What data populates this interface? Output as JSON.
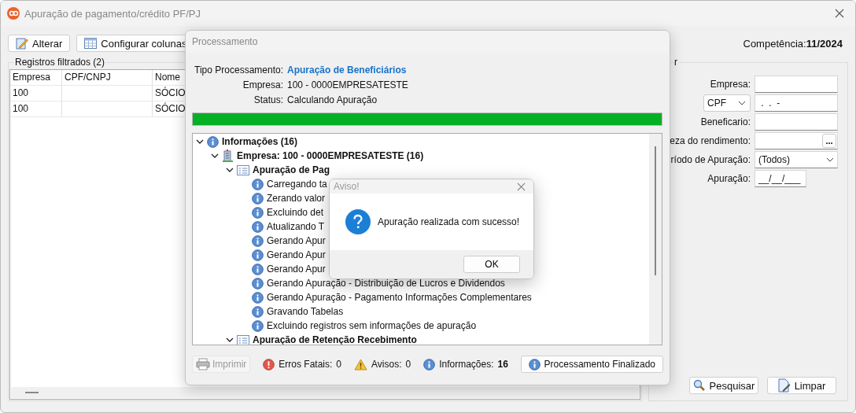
{
  "window": {
    "title": "Apuração de pagamento/crédito PF/PJ"
  },
  "toolbar": {
    "buttons": [
      {
        "label": "Alterar",
        "kind": "edit"
      },
      {
        "label": "Configurar colunas",
        "kind": "columns"
      }
    ],
    "competencia_label": "Competência:",
    "competencia_value": "11/2024"
  },
  "records": {
    "title": "Registros filtrados (2)",
    "columns": [
      "Empresa",
      "CPF/CNPJ",
      "Nome"
    ],
    "rows": [
      {
        "empresa": "100",
        "nome": "SÓCIO"
      },
      {
        "empresa": "100",
        "nome": "SÓCIO"
      }
    ]
  },
  "filter": {
    "title": "r",
    "fields": [
      {
        "label": "Empresa:",
        "kind": "text"
      },
      {
        "kind": "doc",
        "select": "CPF",
        "value": " .  .  -"
      },
      {
        "label": "Beneficario:",
        "kind": "text"
      },
      {
        "label": "eza do rendimento:",
        "kind": "lookup",
        "button": "..."
      },
      {
        "label": "ríodo de Apuração:",
        "kind": "select",
        "value": "(Todos)"
      },
      {
        "label": "Apuração:",
        "kind": "date",
        "value": "__/__/___"
      }
    ],
    "buttons": [
      {
        "label": "Pesquisar",
        "kind": "search"
      },
      {
        "label": "Limpar",
        "kind": "clear"
      }
    ]
  },
  "processing": {
    "title": "Processamento",
    "info": [
      {
        "label": "Tipo Processamento:",
        "value": "Apuração de Beneficiários",
        "link": true
      },
      {
        "label": "Empresa:",
        "value": "100 - 0000EMPRESATESTE",
        "link": false
      },
      {
        "label": "Status:",
        "value": "Calculando Apuração",
        "link": false
      }
    ],
    "progress": {
      "level": 1
    },
    "tree": [
      {
        "text": "Informações (16)",
        "kind": "info",
        "bold": true,
        "expanded": true,
        "children": [
          {
            "text": "Empresa: 100 - 0000EMPRESATESTE (16)",
            "kind": "building",
            "bold": true,
            "expanded": true,
            "children": [
              {
                "text": "Apuração de Pag",
                "kind": "table",
                "bold": true,
                "expanded": true,
                "children": [
                  {
                    "text": "Carregando ta",
                    "kind": "info",
                    "bold": false
                  },
                  {
                    "text": "Zerando valor",
                    "kind": "info",
                    "bold": false
                  },
                  {
                    "text": "Excluindo det",
                    "kind": "info",
                    "bold": false
                  },
                  {
                    "text": "Atualizando T",
                    "kind": "info",
                    "bold": false
                  },
                  {
                    "text": "Gerando Apur",
                    "kind": "info",
                    "bold": false
                  },
                  {
                    "text": "Gerando Apur",
                    "kind": "info",
                    "bold": false
                  },
                  {
                    "text": "Gerando Apur",
                    "kind": "info",
                    "bold": false
                  },
                  {
                    "text": "Gerando Apuração - Distribuição de Lucros e Dividendos",
                    "kind": "info",
                    "bold": false
                  },
                  {
                    "text": "Gerando Apuração - Pagamento Informações Complementares",
                    "kind": "info",
                    "bold": false
                  },
                  {
                    "text": "Gravando Tabelas",
                    "kind": "info",
                    "bold": false
                  },
                  {
                    "text": "Excluindo registros sem informações de apuração",
                    "kind": "info",
                    "bold": false
                  }
                ]
              },
              {
                "text": "Apuração de Retenção Recebimento",
                "kind": "table",
                "bold": true,
                "expanded": true
              }
            ]
          }
        ]
      }
    ],
    "print_button": {
      "label": "Imprimir",
      "disabled": true
    },
    "counters": [
      {
        "kind": "error",
        "label": "Erros Fatais:",
        "value": "0",
        "bold_value": false
      },
      {
        "kind": "warning",
        "label": "Avisos:",
        "value": "0",
        "bold_value": false
      },
      {
        "kind": "info",
        "label": "Informações:",
        "value": "16",
        "bold_value": true
      }
    ],
    "finish_button": "Processamento Finalizado"
  },
  "alert": {
    "title": "Aviso!",
    "message": "Apuração realizada com sucesso!",
    "button": "OK"
  }
}
